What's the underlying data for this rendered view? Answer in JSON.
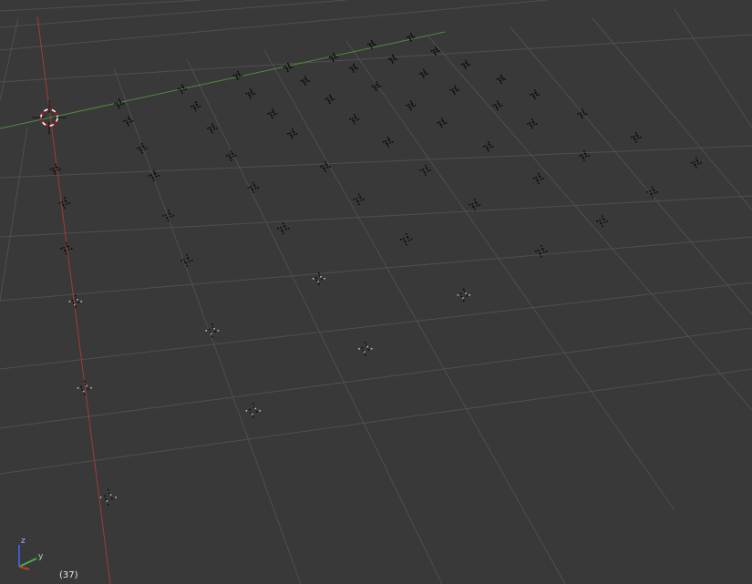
{
  "viewport": {
    "frame_indicator": "(37)",
    "background_color": "#393939",
    "grid_color": "#4f4f4f",
    "x_axis_color": "#a33a3a",
    "y_axis_color": "#4a8f3a",
    "object_color": "#0b0b0b"
  },
  "gizmo": {
    "z_label": "z",
    "y_label": "y",
    "z_color": "#3b5bdc",
    "y_color": "#44b04a",
    "x_color": "#c0392b"
  },
  "cursor": {
    "name": "3d-cursor",
    "colors": [
      "#ffffff",
      "#d0021b"
    ]
  }
}
